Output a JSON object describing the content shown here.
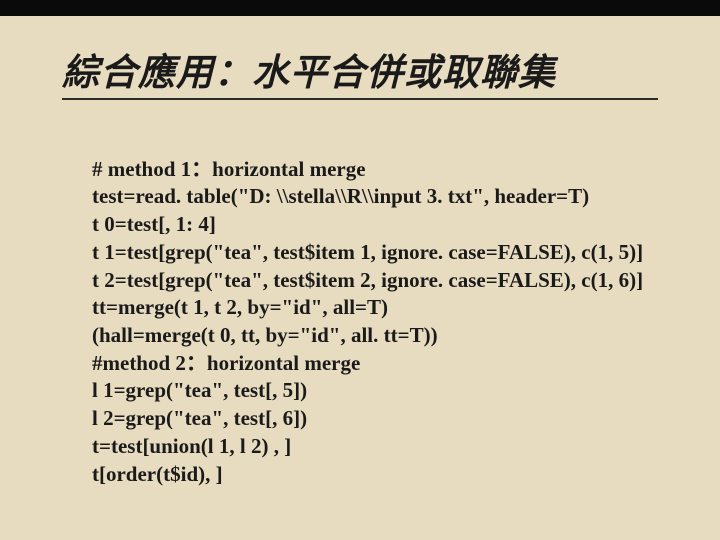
{
  "title": "綜合應用：水平合併或取聯集",
  "code": {
    "line1": "# method 1：horizontal merge",
    "line2": "test=read. table(\"D: \\\\stella\\\\R\\\\input 3. txt\", header=T)",
    "line3": "t 0=test[, 1: 4]",
    "line4": "t 1=test[grep(\"tea\", test$item 1, ignore. case=FALSE), c(1, 5)]",
    "line5": "t 2=test[grep(\"tea\", test$item 2, ignore. case=FALSE), c(1, 6)]",
    "line6": "tt=merge(t 1, t 2, by=\"id\", all=T)",
    "line7": "(hall=merge(t 0, tt, by=\"id\", all. tt=T))",
    "line8": "#method 2：horizontal merge",
    "line9": "l 1=grep(\"tea\", test[, 5])",
    "line10": "l 2=grep(\"tea\", test[, 6])",
    "line11": "t=test[union(l 1, l 2) , ]",
    "line12": "t[order(t$id), ]"
  }
}
